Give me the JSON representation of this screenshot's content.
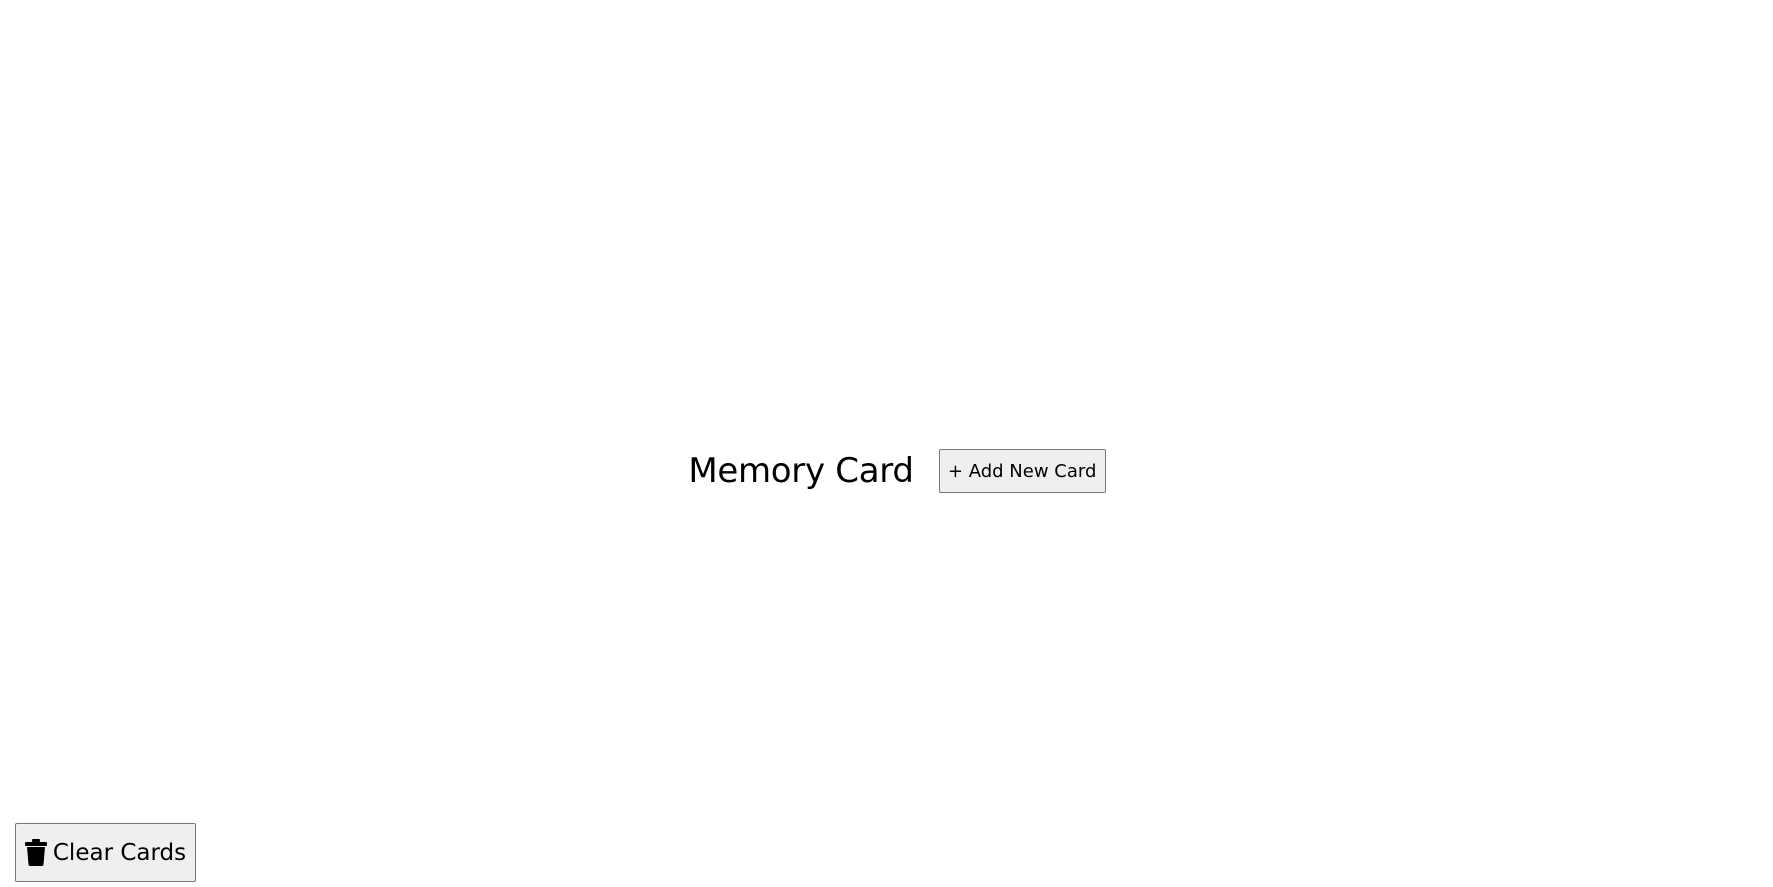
{
  "header": {
    "title": "Memory Card",
    "add_button_label": "+ Add New Card"
  },
  "footer": {
    "clear_button_label": "Clear Cards",
    "clear_button_icon": "trash-icon"
  },
  "colors": {
    "background": "#ffffff",
    "button_bg": "#efefef",
    "button_border": "#767676",
    "text": "#000000"
  }
}
